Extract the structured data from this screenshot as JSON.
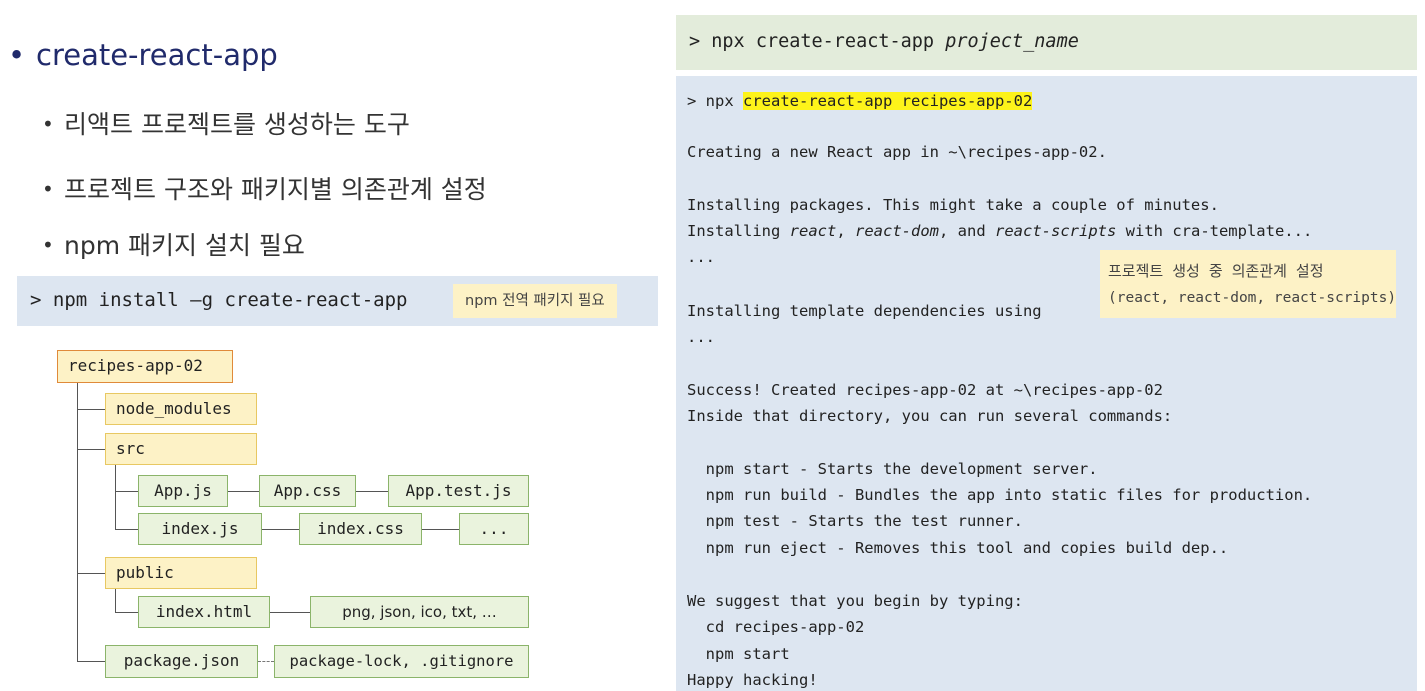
{
  "slide": {
    "bullets": {
      "main": "create-react-app",
      "sub": [
        "리액트 프로젝트를 생성하는 도구",
        "프로젝트 구조와 패키지별 의존관계 설정",
        "npm 패키지 설치 필요"
      ]
    },
    "install": {
      "command": "> npm install –g create-react-app",
      "note": "npm 전역 패키지 필요"
    },
    "tree": {
      "root": "recipes-app-02",
      "node_modules": "node_modules",
      "src": "src",
      "app_js": "App.js",
      "app_css": "App.css",
      "app_test": "App.test.js",
      "index_js": "index.js",
      "index_css": "index.css",
      "src_more": "...",
      "public": "public",
      "index_html": "index.html",
      "public_more": "png, json, ico, txt, …",
      "package_json": "package.json",
      "package_lock": "package-lock, .gitignore"
    },
    "command_bar": {
      "prefix": "> npx create-react-app ",
      "arg": "project_name"
    },
    "terminal": {
      "prompt": "> npx ",
      "highlighted": "create-react-app recipes-app-02",
      "creating": "Creating a new React app in ~\\recipes-app-02.",
      "installing_packages": "Installing packages. This might take a couple of minutes.",
      "installing_prefix": "Installing ",
      "pkg_react": "react",
      "sep1": ", ",
      "pkg_react_dom": "react-dom",
      "sep2": ", and ",
      "pkg_react_scripts": "react-scripts",
      "installing_suffix": " with cra-template...",
      "dots1": "...",
      "template_deps": "Installing template dependencies using",
      "dots2": "...",
      "success": "Success! Created recipes-app-02 at ~\\recipes-app-02",
      "inside": "Inside that directory, you can run several commands:",
      "cmd_start": "  npm start - Starts the development server.",
      "cmd_build": "  npm run build - Bundles the app into static files for production.",
      "cmd_test": "  npm test - Starts the test runner.",
      "cmd_eject": "  npm run eject - Removes this tool and copies build dep..",
      "suggest": "We suggest that you begin by typing:",
      "cd": "  cd recipes-app-02",
      "start": "  npm start",
      "happy": "Happy hacking!"
    },
    "tooltip": {
      "line1": "프로젝트 생성 중 의존관계 설정",
      "line2": "(react, react-dom, react-scripts)"
    },
    "colors": {
      "title": "#202a6b",
      "highlight": "#fdf31a",
      "note_bg": "#fdf2c6",
      "file_bg": "#eaf3dd",
      "terminal_bg": "#dde6f1",
      "command_bar_bg": "#e3ecdb"
    }
  }
}
